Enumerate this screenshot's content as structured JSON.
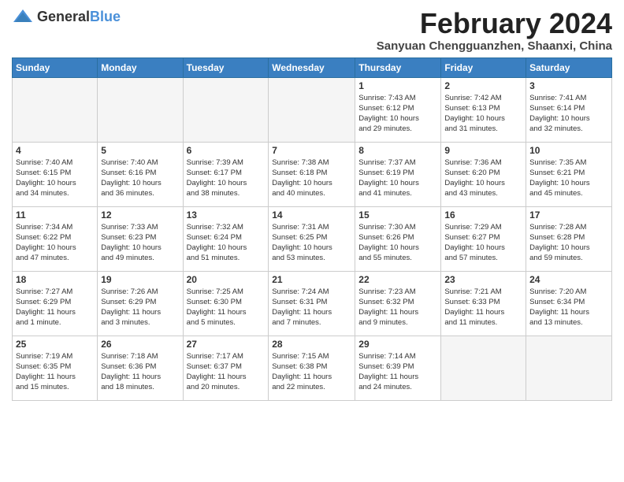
{
  "logo": {
    "general": "General",
    "blue": "Blue"
  },
  "title": {
    "month_year": "February 2024",
    "location": "Sanyuan Chengguanzhen, Shaanxi, China"
  },
  "headers": [
    "Sunday",
    "Monday",
    "Tuesday",
    "Wednesday",
    "Thursday",
    "Friday",
    "Saturday"
  ],
  "weeks": [
    [
      {
        "day": "",
        "detail": ""
      },
      {
        "day": "",
        "detail": ""
      },
      {
        "day": "",
        "detail": ""
      },
      {
        "day": "",
        "detail": ""
      },
      {
        "day": "1",
        "detail": "Sunrise: 7:43 AM\nSunset: 6:12 PM\nDaylight: 10 hours\nand 29 minutes."
      },
      {
        "day": "2",
        "detail": "Sunrise: 7:42 AM\nSunset: 6:13 PM\nDaylight: 10 hours\nand 31 minutes."
      },
      {
        "day": "3",
        "detail": "Sunrise: 7:41 AM\nSunset: 6:14 PM\nDaylight: 10 hours\nand 32 minutes."
      }
    ],
    [
      {
        "day": "4",
        "detail": "Sunrise: 7:40 AM\nSunset: 6:15 PM\nDaylight: 10 hours\nand 34 minutes."
      },
      {
        "day": "5",
        "detail": "Sunrise: 7:40 AM\nSunset: 6:16 PM\nDaylight: 10 hours\nand 36 minutes."
      },
      {
        "day": "6",
        "detail": "Sunrise: 7:39 AM\nSunset: 6:17 PM\nDaylight: 10 hours\nand 38 minutes."
      },
      {
        "day": "7",
        "detail": "Sunrise: 7:38 AM\nSunset: 6:18 PM\nDaylight: 10 hours\nand 40 minutes."
      },
      {
        "day": "8",
        "detail": "Sunrise: 7:37 AM\nSunset: 6:19 PM\nDaylight: 10 hours\nand 41 minutes."
      },
      {
        "day": "9",
        "detail": "Sunrise: 7:36 AM\nSunset: 6:20 PM\nDaylight: 10 hours\nand 43 minutes."
      },
      {
        "day": "10",
        "detail": "Sunrise: 7:35 AM\nSunset: 6:21 PM\nDaylight: 10 hours\nand 45 minutes."
      }
    ],
    [
      {
        "day": "11",
        "detail": "Sunrise: 7:34 AM\nSunset: 6:22 PM\nDaylight: 10 hours\nand 47 minutes."
      },
      {
        "day": "12",
        "detail": "Sunrise: 7:33 AM\nSunset: 6:23 PM\nDaylight: 10 hours\nand 49 minutes."
      },
      {
        "day": "13",
        "detail": "Sunrise: 7:32 AM\nSunset: 6:24 PM\nDaylight: 10 hours\nand 51 minutes."
      },
      {
        "day": "14",
        "detail": "Sunrise: 7:31 AM\nSunset: 6:25 PM\nDaylight: 10 hours\nand 53 minutes."
      },
      {
        "day": "15",
        "detail": "Sunrise: 7:30 AM\nSunset: 6:26 PM\nDaylight: 10 hours\nand 55 minutes."
      },
      {
        "day": "16",
        "detail": "Sunrise: 7:29 AM\nSunset: 6:27 PM\nDaylight: 10 hours\nand 57 minutes."
      },
      {
        "day": "17",
        "detail": "Sunrise: 7:28 AM\nSunset: 6:28 PM\nDaylight: 10 hours\nand 59 minutes."
      }
    ],
    [
      {
        "day": "18",
        "detail": "Sunrise: 7:27 AM\nSunset: 6:29 PM\nDaylight: 11 hours\nand 1 minute."
      },
      {
        "day": "19",
        "detail": "Sunrise: 7:26 AM\nSunset: 6:29 PM\nDaylight: 11 hours\nand 3 minutes."
      },
      {
        "day": "20",
        "detail": "Sunrise: 7:25 AM\nSunset: 6:30 PM\nDaylight: 11 hours\nand 5 minutes."
      },
      {
        "day": "21",
        "detail": "Sunrise: 7:24 AM\nSunset: 6:31 PM\nDaylight: 11 hours\nand 7 minutes."
      },
      {
        "day": "22",
        "detail": "Sunrise: 7:23 AM\nSunset: 6:32 PM\nDaylight: 11 hours\nand 9 minutes."
      },
      {
        "day": "23",
        "detail": "Sunrise: 7:21 AM\nSunset: 6:33 PM\nDaylight: 11 hours\nand 11 minutes."
      },
      {
        "day": "24",
        "detail": "Sunrise: 7:20 AM\nSunset: 6:34 PM\nDaylight: 11 hours\nand 13 minutes."
      }
    ],
    [
      {
        "day": "25",
        "detail": "Sunrise: 7:19 AM\nSunset: 6:35 PM\nDaylight: 11 hours\nand 15 minutes."
      },
      {
        "day": "26",
        "detail": "Sunrise: 7:18 AM\nSunset: 6:36 PM\nDaylight: 11 hours\nand 18 minutes."
      },
      {
        "day": "27",
        "detail": "Sunrise: 7:17 AM\nSunset: 6:37 PM\nDaylight: 11 hours\nand 20 minutes."
      },
      {
        "day": "28",
        "detail": "Sunrise: 7:15 AM\nSunset: 6:38 PM\nDaylight: 11 hours\nand 22 minutes."
      },
      {
        "day": "29",
        "detail": "Sunrise: 7:14 AM\nSunset: 6:39 PM\nDaylight: 11 hours\nand 24 minutes."
      },
      {
        "day": "",
        "detail": ""
      },
      {
        "day": "",
        "detail": ""
      }
    ]
  ]
}
